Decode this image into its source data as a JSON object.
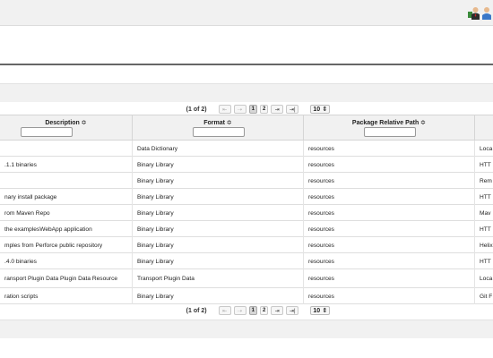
{
  "pager": {
    "count": "(1 of 2)",
    "first": "⇤",
    "prev": "⇢",
    "page1": "1",
    "page2": "2",
    "next": "⇥",
    "last": "⇥|",
    "rows_per_page": "10",
    "rows_caret": "⇕"
  },
  "table": {
    "columns": [
      {
        "label": "Description ≎"
      },
      {
        "label": "Format ≎"
      },
      {
        "label": "Package Relative Path ≎"
      }
    ],
    "rows": [
      {
        "desc": "",
        "format": "Data Dictionary",
        "path": "resources",
        "type": "Loca"
      },
      {
        "desc": ".1.1 binaries",
        "format": "Binary Library",
        "path": "resources",
        "type": "HTT"
      },
      {
        "desc": "",
        "format": "Binary Library",
        "path": "resources",
        "type": "Rem"
      },
      {
        "desc": "nary install package",
        "format": "Binary Library",
        "path": "resources",
        "type": "HTT"
      },
      {
        "desc": "rom Maven Repo",
        "format": "Binary Library",
        "path": "resources",
        "type": "Mav"
      },
      {
        "desc": "the examplesWebApp application",
        "format": "Binary Library",
        "path": "resources",
        "type": "HTT"
      },
      {
        "desc": "mples from Perforce public repository",
        "format": "Binary Library",
        "path": "resources",
        "type": "Helix"
      },
      {
        "desc": ".4.0 binaries",
        "format": "Binary Library",
        "path": "resources",
        "type": "HTT"
      },
      {
        "desc": "ransport Plugin Data Plugin Data Resource",
        "format": "Transport Plugin Data",
        "path": "resources",
        "type": "Loca"
      },
      {
        "desc": "ration scripts",
        "format": "Binary Library",
        "path": "resources",
        "type": "Git F"
      }
    ]
  }
}
